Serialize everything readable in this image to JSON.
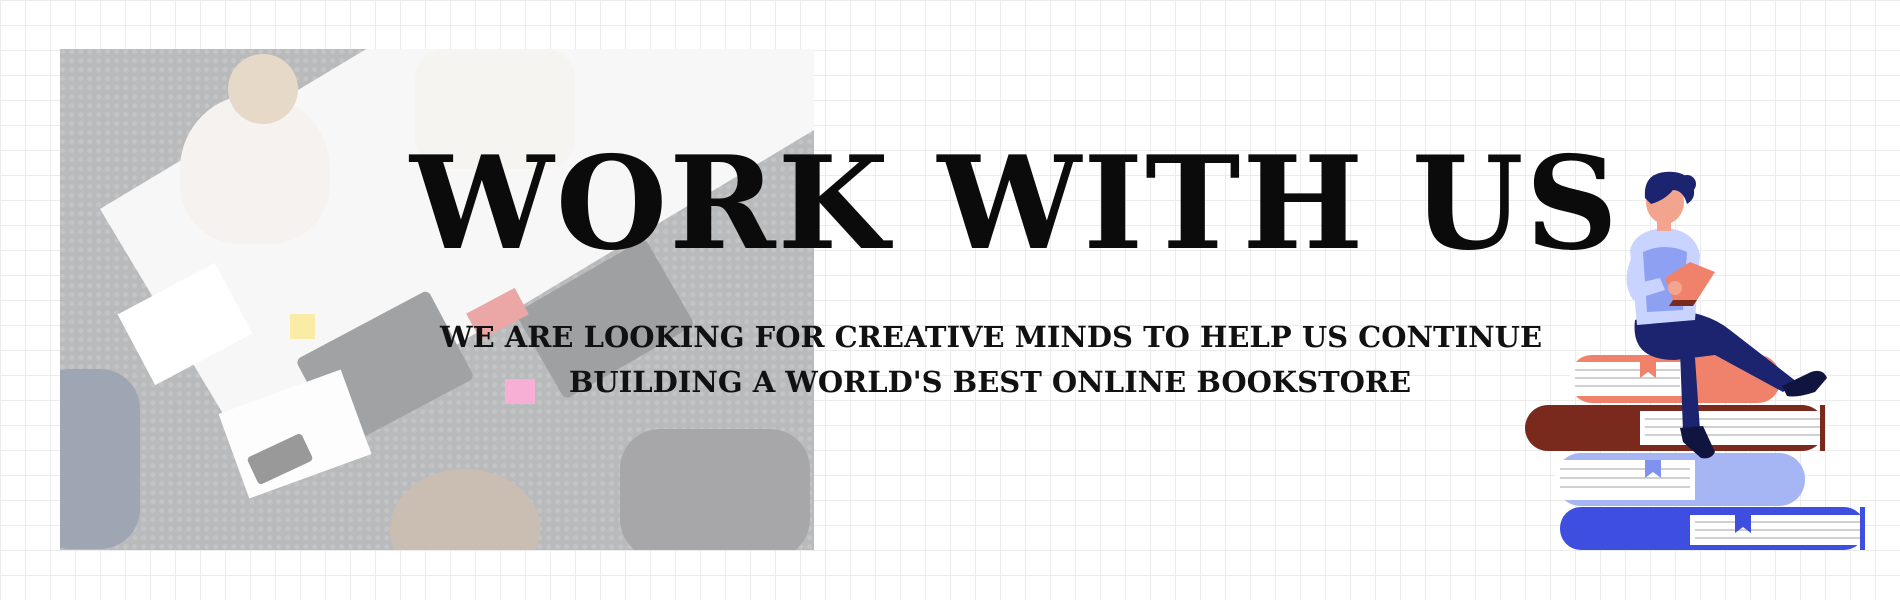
{
  "banner": {
    "headline": "WORK WITH US",
    "subheadline_line1": "WE ARE LOOKING FOR CREATIVE MINDS TO HELP US CONTINUE",
    "subheadline_line2": "BUILDING A WORLD'S BEST ONLINE BOOKSTORE"
  },
  "colors": {
    "headline": "#0b0b0b",
    "grid_line": "#ececec",
    "book_salmon": "#f0826c",
    "book_brown": "#7a2a1c",
    "book_light_blue": "#a6b6f5",
    "book_blue": "#3d4ee0",
    "pants_navy": "#1c2470",
    "vest_lavender": "#c9d3ff"
  },
  "icons": {
    "photo": "office-team-photo",
    "illustration": "person-reading-on-books-illustration"
  }
}
